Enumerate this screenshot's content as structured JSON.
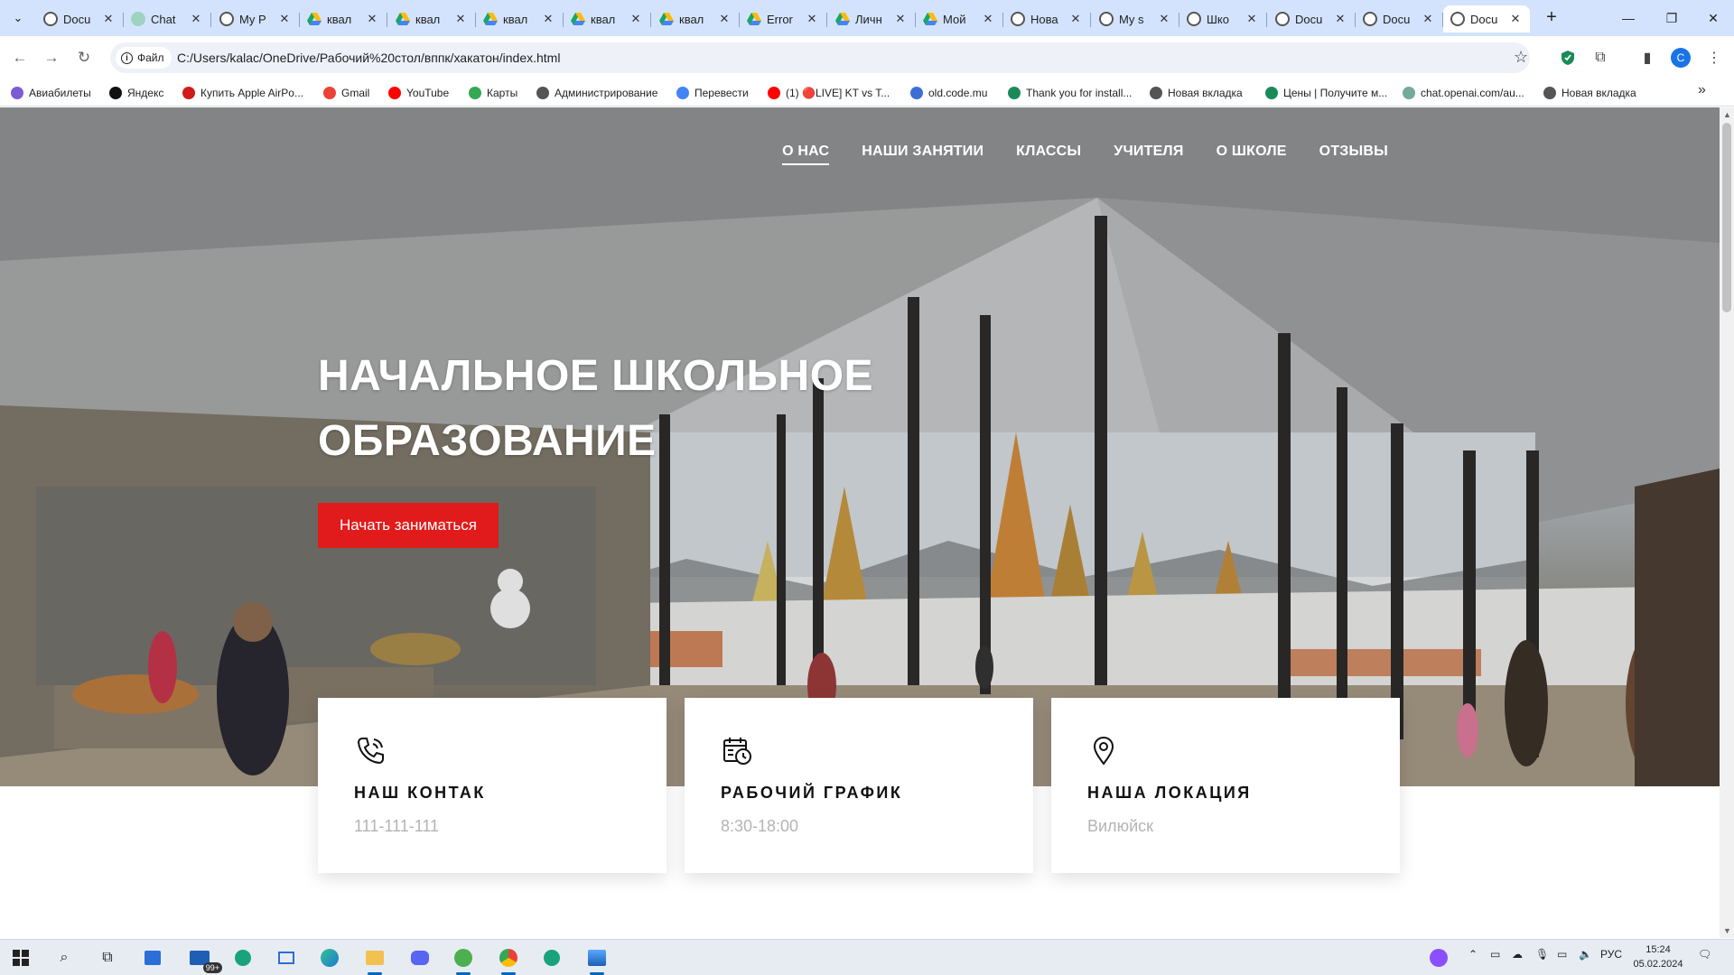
{
  "browser": {
    "tabs": [
      {
        "title": "Docu",
        "icon": "globe",
        "active": false
      },
      {
        "title": "Chat",
        "icon": "chatgpt",
        "active": false
      },
      {
        "title": "My P",
        "icon": "globe",
        "active": false
      },
      {
        "title": "квал",
        "icon": "drive",
        "active": false
      },
      {
        "title": "квал",
        "icon": "drive",
        "active": false
      },
      {
        "title": "квал",
        "icon": "drive",
        "active": false
      },
      {
        "title": "квал",
        "icon": "drive",
        "active": false
      },
      {
        "title": "квал",
        "icon": "drive",
        "active": false
      },
      {
        "title": "Error",
        "icon": "drive",
        "active": false
      },
      {
        "title": "Личн",
        "icon": "drive",
        "active": false
      },
      {
        "title": "Мой",
        "icon": "drive",
        "active": false
      },
      {
        "title": "Нова",
        "icon": "globe",
        "active": false
      },
      {
        "title": "My s",
        "icon": "globe",
        "active": false
      },
      {
        "title": "Шко",
        "icon": "globe",
        "active": false
      },
      {
        "title": "Docu",
        "icon": "globe",
        "active": false
      },
      {
        "title": "Docu",
        "icon": "globe",
        "active": false
      },
      {
        "title": "Docu",
        "icon": "globe",
        "active": true
      }
    ],
    "site_info_label": "Файл",
    "url": "C:/Users/kalac/OneDrive/Рабочий%20стол/вппк/хакатон/index.html",
    "profile_initial": "C",
    "bookmarks": [
      {
        "label": "Авиабилеты",
        "color": "#7b5cd6"
      },
      {
        "label": "Яндекс",
        "color": "#111111"
      },
      {
        "label": "Купить Apple AirPo...",
        "color": "#d11a1a"
      },
      {
        "label": "Gmail",
        "color": "#ea4335"
      },
      {
        "label": "YouTube",
        "color": "#ff0000"
      },
      {
        "label": "Карты",
        "color": "#34a853"
      },
      {
        "label": "Администрирование",
        "color": "#555555"
      },
      {
        "label": "Перевести",
        "color": "#4285f4"
      },
      {
        "label": "(1) 🔴LIVE] KT vs T...",
        "color": "#ff0000"
      },
      {
        "label": "old.code.mu",
        "color": "#3b6fd6"
      },
      {
        "label": "Thank you for install...",
        "color": "#1b8a5a"
      },
      {
        "label": "Новая вкладка",
        "color": "#555555"
      },
      {
        "label": "Цены | Получите м...",
        "color": "#1b8a5a"
      },
      {
        "label": "chat.openai.com/au...",
        "color": "#74aa9c"
      },
      {
        "label": "Новая вкладка",
        "color": "#555555"
      }
    ]
  },
  "page": {
    "nav": [
      "О НАС",
      "НАШИ ЗАНЯТИИ",
      "КЛАССЫ",
      "УЧИТЕЛЯ",
      "О ШКОЛЕ",
      "ОТЗЫВЫ"
    ],
    "hero_title": "НАЧАЛЬНОЕ ШКОЛЬНОЕ ОБРАЗОВАНИЕ",
    "cta_label": "Начать заниматься",
    "accent_color": "#e11b1b",
    "cards": [
      {
        "icon": "phone-icon",
        "title": "НАШ КОНТАК",
        "value": "111-111-111"
      },
      {
        "icon": "calendar-clock-icon",
        "title": "РАБОЧИЙ ГРАФИК",
        "value": "8:30-18:00"
      },
      {
        "icon": "location-pin-icon",
        "title": "НАША ЛОКАЦИЯ",
        "value": "Вилюйск"
      }
    ]
  },
  "taskbar": {
    "mail_badge": "99+",
    "language": "РУС",
    "time": "15:24",
    "date": "05.02.2024"
  }
}
